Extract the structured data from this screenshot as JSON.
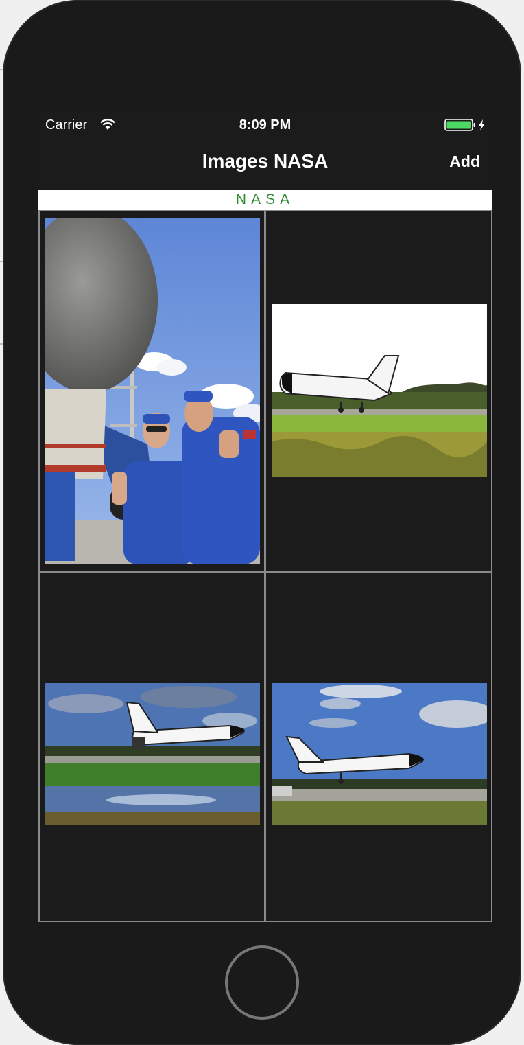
{
  "status_bar": {
    "carrier": "Carrier",
    "time": "8:09 PM",
    "icons": [
      "wifi-icon",
      "battery-icon",
      "charging-bolt-icon"
    ]
  },
  "nav": {
    "title": "Images NASA",
    "add_label": "Add"
  },
  "section": {
    "header": "NASA",
    "header_color": "#2e8b2e"
  },
  "grid": {
    "items": [
      {
        "subject": "astronauts-thumbs-up-photo"
      },
      {
        "subject": "shuttle-landing-smoke-photo"
      },
      {
        "subject": "shuttle-landing-marsh-photo"
      },
      {
        "subject": "shuttle-landing-runway-photo"
      }
    ]
  },
  "home_button": {
    "icon": "home-button-icon"
  }
}
